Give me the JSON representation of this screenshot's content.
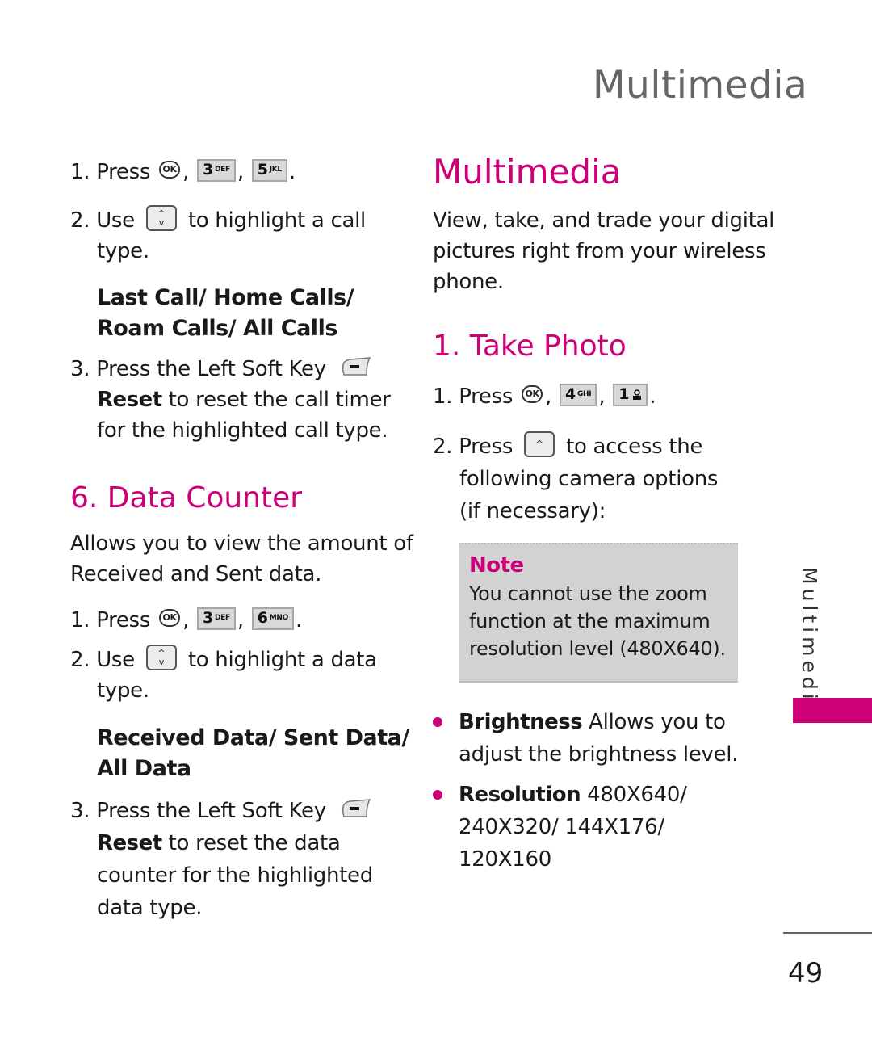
{
  "colors": {
    "accent": "#cc0077",
    "header_gray": "#666666",
    "note_bg": "#d2d2d2"
  },
  "page_header": "Multimedia",
  "left_column": {
    "call_steps": [
      {
        "num": "1.",
        "prefix": "Press",
        "keys": [
          "OK",
          "3 DEF",
          "5 JKL"
        ]
      },
      {
        "num": "2.",
        "prefix": "Use",
        "suffix_line1": "to highlight a call",
        "line2": "type."
      },
      {
        "options": "Last Call/ Home Calls/ Roam Calls/ All Calls"
      },
      {
        "num": "3.",
        "line1": "Press the Left Soft Key",
        "bold": "Reset",
        "rest1": " to reset the call timer",
        "line3": "for the highlighted call type."
      }
    ],
    "data_counter": {
      "heading": "6. Data Counter",
      "intro_line1": "Allows you to view the amount of",
      "intro_line2": "Received and Sent data.",
      "step1_prefix": "Press",
      "step1_keys": [
        "OK",
        "3 DEF",
        "6 MNO"
      ],
      "step2_prefix": "Use",
      "step2_suffix": "to highlight a data",
      "step2_line2": "type.",
      "options_line1": "Received Data/ Sent Data/",
      "options_line2": "All Data",
      "step3_line1": "Press the Left Soft Key",
      "step3_bold": "Reset",
      "step3_rest": " to reset the data",
      "step3_line3": "counter for the highlighted",
      "step3_line4": "data type."
    }
  },
  "right_column": {
    "heading": "Multimedia",
    "intro_lines": [
      "View, take, and trade your digital",
      "pictures right from your wireless",
      "phone."
    ],
    "take_photo": {
      "heading": "1. Take Photo",
      "step1_prefix": "Press",
      "step1_keys": [
        "OK",
        "4 GHI",
        "1 voicemail"
      ],
      "step2_prefix": "Press",
      "step2_suffix": "to access the",
      "step2_line2": "following camera options",
      "step2_line3": "(if necessary):"
    },
    "note": {
      "title": "Note",
      "lines": [
        "You cannot use the zoom",
        "function at the maximum",
        "resolution level (480X640)."
      ]
    },
    "bullets": [
      {
        "bold": "Brightness",
        "text": " Allows you to",
        "line2": "adjust the brightness level."
      },
      {
        "bold": "Resolution",
        "text": " 480X640/",
        "line2": "240X320/ 144X176/",
        "line3": "120X160"
      }
    ]
  },
  "side_tab_label": "Multimedia",
  "page_number": "49",
  "key_labels": {
    "ok": "OK",
    "k3d": "3",
    "k3l": "DEF",
    "k5d": "5",
    "k5l": "JKL",
    "k6d": "6",
    "k6l": "MNO",
    "k4d": "4",
    "k4l": "GHI",
    "k1d": "1",
    "up": "^",
    "down": "v",
    "comma": ",",
    "period": "."
  }
}
